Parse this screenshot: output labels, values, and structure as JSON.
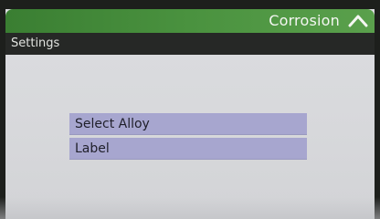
{
  "header": {
    "title": "Corrosion",
    "collapse_icon": "chevron-up-icon",
    "color": "#4a923f"
  },
  "titlebar": {
    "title": "Settings"
  },
  "menu": {
    "items": [
      {
        "label": "Select Alloy"
      },
      {
        "label": "Label"
      }
    ],
    "item_color": "#a7a6cf"
  }
}
